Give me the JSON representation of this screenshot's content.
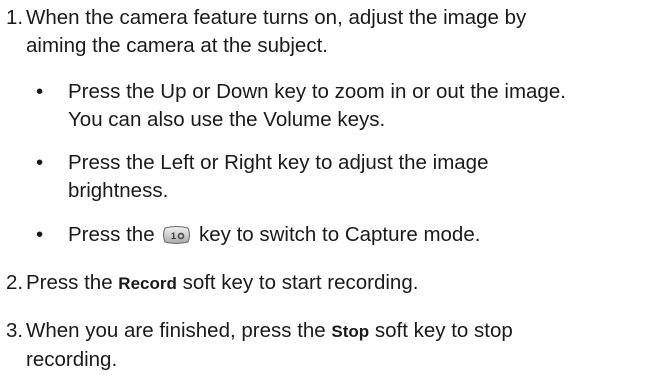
{
  "steps": [
    {
      "number": "1.",
      "line1": "When the camera feature turns on, adjust the image by",
      "line2": "aiming the camera at the subject."
    },
    {
      "number": "2.",
      "text_before": "Press the ",
      "softkey": "Record",
      "text_after": " soft key to start recording."
    },
    {
      "number": "3.",
      "text_before": "When you are finished, press the ",
      "softkey": "Stop",
      "text_after": " soft key to stop",
      "line2": "recording."
    }
  ],
  "bullets": [
    {
      "marker": "•",
      "line1": "Press the Up or Down key to zoom in or out the image.",
      "line2": "You can also use the Volume keys."
    },
    {
      "marker": "•",
      "line1": "Press the Left or Right key to adjust the image",
      "line2": "brightness."
    },
    {
      "marker": "•",
      "text_before": "Press the ",
      "icon": "camera-key-1-icon",
      "text_after": " key to switch to Capture mode."
    }
  ]
}
